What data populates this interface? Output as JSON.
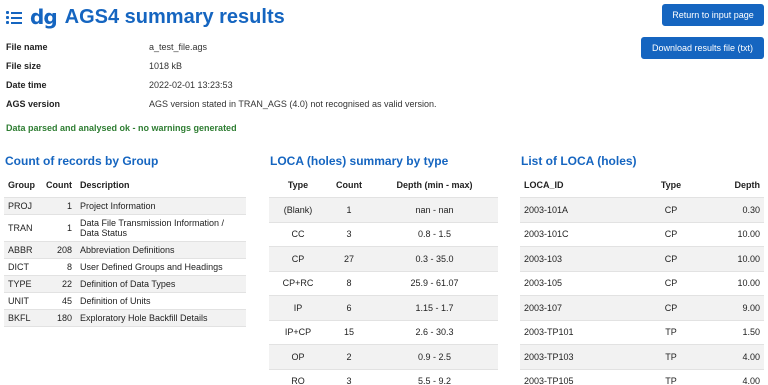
{
  "header": {
    "logo": "dg",
    "title": "AGS4 summary results",
    "return_label": "Return to input page",
    "download_label": "Download results file (txt)"
  },
  "meta": [
    {
      "label": "File name",
      "value": "a_test_file.ags"
    },
    {
      "label": "File size",
      "value": "1018 kB"
    },
    {
      "label": "Date time",
      "value": "2022-02-01 13:23:53"
    },
    {
      "label": "AGS version",
      "value": "AGS version stated in TRAN_AGS (4.0) not recognised as valid version."
    }
  ],
  "status": "Data parsed and analysed ok - no warnings generated",
  "groups": {
    "title": "Count of records by Group",
    "headers": [
      "Group",
      "Count",
      "Description"
    ],
    "rows": [
      [
        "PROJ",
        "1",
        "Project Information"
      ],
      [
        "TRAN",
        "1",
        "Data File Transmission Information / Data Status"
      ],
      [
        "ABBR",
        "208",
        "Abbreviation Definitions"
      ],
      [
        "DICT",
        "8",
        "User Defined Groups and Headings"
      ],
      [
        "TYPE",
        "22",
        "Definition of Data Types"
      ],
      [
        "UNIT",
        "45",
        "Definition of Units"
      ],
      [
        "BKFL",
        "180",
        "Exploratory Hole Backfill Details"
      ]
    ]
  },
  "loca_summary": {
    "title": "LOCA (holes) summary by type",
    "headers": [
      "Type",
      "Count",
      "Depth (min - max)"
    ],
    "rows": [
      [
        "(Blank)",
        "1",
        "nan - nan"
      ],
      [
        "CC",
        "3",
        "0.8 - 1.5"
      ],
      [
        "CP",
        "27",
        "0.3 - 35.0"
      ],
      [
        "CP+RC",
        "8",
        "25.9 - 61.07"
      ],
      [
        "IP",
        "6",
        "1.15 - 1.7"
      ],
      [
        "IP+CP",
        "15",
        "2.6 - 30.3"
      ],
      [
        "OP",
        "2",
        "0.9 - 2.5"
      ],
      [
        "RO",
        "3",
        "5.5 - 9.2"
      ]
    ]
  },
  "loca_list": {
    "title": "List of LOCA (holes)",
    "headers": [
      "LOCA_ID",
      "Type",
      "Depth"
    ],
    "rows": [
      [
        "2003-101A",
        "CP",
        "0.30"
      ],
      [
        "2003-101C",
        "CP",
        "10.00"
      ],
      [
        "2003-103",
        "CP",
        "10.00"
      ],
      [
        "2003-105",
        "CP",
        "10.00"
      ],
      [
        "2003-107",
        "CP",
        "9.00"
      ],
      [
        "2003-TP101",
        "TP",
        "1.50"
      ],
      [
        "2003-TP103",
        "TP",
        "4.00"
      ],
      [
        "2003-TP105",
        "TP",
        "4.00"
      ]
    ]
  }
}
